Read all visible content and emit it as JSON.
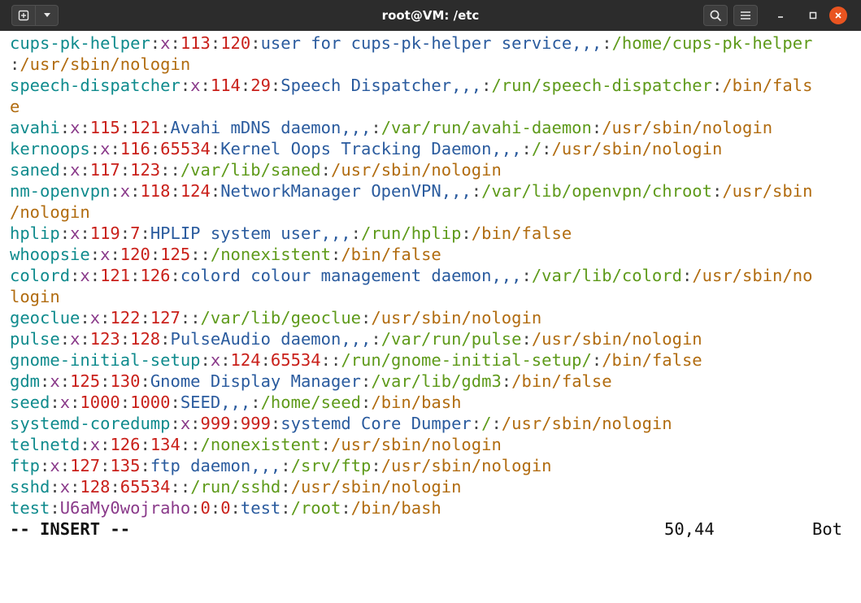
{
  "window": {
    "title": "root@VM: /etc",
    "new_tab_icon": "new-tab-icon",
    "dropdown_icon": "chevron-down-icon",
    "search_icon": "search-icon",
    "menu_icon": "hamburger-menu-icon",
    "minimize_icon": "minimize-icon",
    "maximize_icon": "maximize-icon",
    "close_icon": "close-icon",
    "close_color": "#e95420"
  },
  "terminal": {
    "lines": [
      [
        [
          "cups-pk-helper",
          "user"
        ],
        [
          ":",
          "sep"
        ],
        [
          "x",
          "pw"
        ],
        [
          ":",
          "sep"
        ],
        [
          "113",
          "id"
        ],
        [
          ":",
          "sep"
        ],
        [
          "120",
          "id"
        ],
        [
          ":",
          "sep"
        ],
        [
          "user for cups-pk-helper service,,,",
          "desc"
        ],
        [
          ":",
          "sep"
        ],
        [
          "/home/cups-pk-helper",
          "home"
        ]
      ],
      [
        [
          ":",
          "sep"
        ],
        [
          "/usr/sbin/nologin",
          "shell"
        ]
      ],
      [
        [
          "speech-dispatcher",
          "user"
        ],
        [
          ":",
          "sep"
        ],
        [
          "x",
          "pw"
        ],
        [
          ":",
          "sep"
        ],
        [
          "114",
          "id"
        ],
        [
          ":",
          "sep"
        ],
        [
          "29",
          "id"
        ],
        [
          ":",
          "sep"
        ],
        [
          "Speech Dispatcher,,,",
          "desc"
        ],
        [
          ":",
          "sep"
        ],
        [
          "/run/speech-dispatcher",
          "home"
        ],
        [
          ":",
          "sep"
        ],
        [
          "/bin/fals",
          "shell"
        ]
      ],
      [
        [
          "e",
          "shell"
        ]
      ],
      [
        [
          "avahi",
          "user"
        ],
        [
          ":",
          "sep"
        ],
        [
          "x",
          "pw"
        ],
        [
          ":",
          "sep"
        ],
        [
          "115",
          "id"
        ],
        [
          ":",
          "sep"
        ],
        [
          "121",
          "id"
        ],
        [
          ":",
          "sep"
        ],
        [
          "Avahi mDNS daemon,,,",
          "desc"
        ],
        [
          ":",
          "sep"
        ],
        [
          "/var/run/avahi-daemon",
          "home"
        ],
        [
          ":",
          "sep"
        ],
        [
          "/usr/sbin/nologin",
          "shell"
        ]
      ],
      [
        [
          "kernoops",
          "user"
        ],
        [
          ":",
          "sep"
        ],
        [
          "x",
          "pw"
        ],
        [
          ":",
          "sep"
        ],
        [
          "116",
          "id"
        ],
        [
          ":",
          "sep"
        ],
        [
          "65534",
          "id"
        ],
        [
          ":",
          "sep"
        ],
        [
          "Kernel Oops Tracking Daemon,,,",
          "desc"
        ],
        [
          ":",
          "sep"
        ],
        [
          "/",
          "home"
        ],
        [
          ":",
          "sep"
        ],
        [
          "/usr/sbin/nologin",
          "shell"
        ]
      ],
      [
        [
          "saned",
          "user"
        ],
        [
          ":",
          "sep"
        ],
        [
          "x",
          "pw"
        ],
        [
          ":",
          "sep"
        ],
        [
          "117",
          "id"
        ],
        [
          ":",
          "sep"
        ],
        [
          "123",
          "id"
        ],
        [
          ":",
          "sep"
        ],
        [
          ":",
          "sep"
        ],
        [
          "/var/lib/saned",
          "home"
        ],
        [
          ":",
          "sep"
        ],
        [
          "/usr/sbin/nologin",
          "shell"
        ]
      ],
      [
        [
          "nm-openvpn",
          "user"
        ],
        [
          ":",
          "sep"
        ],
        [
          "x",
          "pw"
        ],
        [
          ":",
          "sep"
        ],
        [
          "118",
          "id"
        ],
        [
          ":",
          "sep"
        ],
        [
          "124",
          "id"
        ],
        [
          ":",
          "sep"
        ],
        [
          "NetworkManager OpenVPN,,,",
          "desc"
        ],
        [
          ":",
          "sep"
        ],
        [
          "/var/lib/openvpn/chroot",
          "home"
        ],
        [
          ":",
          "sep"
        ],
        [
          "/usr/sbin",
          "shell"
        ]
      ],
      [
        [
          "/nologin",
          "shell"
        ]
      ],
      [
        [
          "hplip",
          "user"
        ],
        [
          ":",
          "sep"
        ],
        [
          "x",
          "pw"
        ],
        [
          ":",
          "sep"
        ],
        [
          "119",
          "id"
        ],
        [
          ":",
          "sep"
        ],
        [
          "7",
          "id"
        ],
        [
          ":",
          "sep"
        ],
        [
          "HPLIP system user,,,",
          "desc"
        ],
        [
          ":",
          "sep"
        ],
        [
          "/run/hplip",
          "home"
        ],
        [
          ":",
          "sep"
        ],
        [
          "/bin/false",
          "shell"
        ]
      ],
      [
        [
          "whoopsie",
          "user"
        ],
        [
          ":",
          "sep"
        ],
        [
          "x",
          "pw"
        ],
        [
          ":",
          "sep"
        ],
        [
          "120",
          "id"
        ],
        [
          ":",
          "sep"
        ],
        [
          "125",
          "id"
        ],
        [
          ":",
          "sep"
        ],
        [
          ":",
          "sep"
        ],
        [
          "/nonexistent",
          "home"
        ],
        [
          ":",
          "sep"
        ],
        [
          "/bin/false",
          "shell"
        ]
      ],
      [
        [
          "colord",
          "user"
        ],
        [
          ":",
          "sep"
        ],
        [
          "x",
          "pw"
        ],
        [
          ":",
          "sep"
        ],
        [
          "121",
          "id"
        ],
        [
          ":",
          "sep"
        ],
        [
          "126",
          "id"
        ],
        [
          ":",
          "sep"
        ],
        [
          "colord colour management daemon,,,",
          "desc"
        ],
        [
          ":",
          "sep"
        ],
        [
          "/var/lib/colord",
          "home"
        ],
        [
          ":",
          "sep"
        ],
        [
          "/usr/sbin/no",
          "shell"
        ]
      ],
      [
        [
          "login",
          "shell"
        ]
      ],
      [
        [
          "geoclue",
          "user"
        ],
        [
          ":",
          "sep"
        ],
        [
          "x",
          "pw"
        ],
        [
          ":",
          "sep"
        ],
        [
          "122",
          "id"
        ],
        [
          ":",
          "sep"
        ],
        [
          "127",
          "id"
        ],
        [
          ":",
          "sep"
        ],
        [
          ":",
          "sep"
        ],
        [
          "/var/lib/geoclue",
          "home"
        ],
        [
          ":",
          "sep"
        ],
        [
          "/usr/sbin/nologin",
          "shell"
        ]
      ],
      [
        [
          "pulse",
          "user"
        ],
        [
          ":",
          "sep"
        ],
        [
          "x",
          "pw"
        ],
        [
          ":",
          "sep"
        ],
        [
          "123",
          "id"
        ],
        [
          ":",
          "sep"
        ],
        [
          "128",
          "id"
        ],
        [
          ":",
          "sep"
        ],
        [
          "PulseAudio daemon,,,",
          "desc"
        ],
        [
          ":",
          "sep"
        ],
        [
          "/var/run/pulse",
          "home"
        ],
        [
          ":",
          "sep"
        ],
        [
          "/usr/sbin/nologin",
          "shell"
        ]
      ],
      [
        [
          "gnome-initial-setup",
          "user"
        ],
        [
          ":",
          "sep"
        ],
        [
          "x",
          "pw"
        ],
        [
          ":",
          "sep"
        ],
        [
          "124",
          "id"
        ],
        [
          ":",
          "sep"
        ],
        [
          "65534",
          "id"
        ],
        [
          ":",
          "sep"
        ],
        [
          ":",
          "sep"
        ],
        [
          "/run/gnome-initial-setup/",
          "home"
        ],
        [
          ":",
          "sep"
        ],
        [
          "/bin/false",
          "shell"
        ]
      ],
      [
        [
          "gdm",
          "user"
        ],
        [
          ":",
          "sep"
        ],
        [
          "x",
          "pw"
        ],
        [
          ":",
          "sep"
        ],
        [
          "125",
          "id"
        ],
        [
          ":",
          "sep"
        ],
        [
          "130",
          "id"
        ],
        [
          ":",
          "sep"
        ],
        [
          "Gnome Display Manager",
          "desc"
        ],
        [
          ":",
          "sep"
        ],
        [
          "/var/lib/gdm3",
          "home"
        ],
        [
          ":",
          "sep"
        ],
        [
          "/bin/false",
          "shell"
        ]
      ],
      [
        [
          "seed",
          "user"
        ],
        [
          ":",
          "sep"
        ],
        [
          "x",
          "pw"
        ],
        [
          ":",
          "sep"
        ],
        [
          "1000",
          "id"
        ],
        [
          ":",
          "sep"
        ],
        [
          "1000",
          "id"
        ],
        [
          ":",
          "sep"
        ],
        [
          "SEED,,,",
          "desc"
        ],
        [
          ":",
          "sep"
        ],
        [
          "/home/seed",
          "home"
        ],
        [
          ":",
          "sep"
        ],
        [
          "/bin/bash",
          "shell"
        ]
      ],
      [
        [
          "systemd-coredump",
          "user"
        ],
        [
          ":",
          "sep"
        ],
        [
          "x",
          "pw"
        ],
        [
          ":",
          "sep"
        ],
        [
          "999",
          "id"
        ],
        [
          ":",
          "sep"
        ],
        [
          "999",
          "id"
        ],
        [
          ":",
          "sep"
        ],
        [
          "systemd Core Dumper",
          "desc"
        ],
        [
          ":",
          "sep"
        ],
        [
          "/",
          "home"
        ],
        [
          ":",
          "sep"
        ],
        [
          "/usr/sbin/nologin",
          "shell"
        ]
      ],
      [
        [
          "telnetd",
          "user"
        ],
        [
          ":",
          "sep"
        ],
        [
          "x",
          "pw"
        ],
        [
          ":",
          "sep"
        ],
        [
          "126",
          "id"
        ],
        [
          ":",
          "sep"
        ],
        [
          "134",
          "id"
        ],
        [
          ":",
          "sep"
        ],
        [
          ":",
          "sep"
        ],
        [
          "/nonexistent",
          "home"
        ],
        [
          ":",
          "sep"
        ],
        [
          "/usr/sbin/nologin",
          "shell"
        ]
      ],
      [
        [
          "ftp",
          "user"
        ],
        [
          ":",
          "sep"
        ],
        [
          "x",
          "pw"
        ],
        [
          ":",
          "sep"
        ],
        [
          "127",
          "id"
        ],
        [
          ":",
          "sep"
        ],
        [
          "135",
          "id"
        ],
        [
          ":",
          "sep"
        ],
        [
          "ftp daemon,,,",
          "desc"
        ],
        [
          ":",
          "sep"
        ],
        [
          "/srv/ftp",
          "home"
        ],
        [
          ":",
          "sep"
        ],
        [
          "/usr/sbin/nologin",
          "shell"
        ]
      ],
      [
        [
          "sshd",
          "user"
        ],
        [
          ":",
          "sep"
        ],
        [
          "x",
          "pw"
        ],
        [
          ":",
          "sep"
        ],
        [
          "128",
          "id"
        ],
        [
          ":",
          "sep"
        ],
        [
          "65534",
          "id"
        ],
        [
          ":",
          "sep"
        ],
        [
          ":",
          "sep"
        ],
        [
          "/run/sshd",
          "home"
        ],
        [
          ":",
          "sep"
        ],
        [
          "/usr/sbin/nologin",
          "shell"
        ]
      ],
      [
        [
          "test",
          "user"
        ],
        [
          ":",
          "sep"
        ],
        [
          "U6aMy0wojraho",
          "pw"
        ],
        [
          ":",
          "sep"
        ],
        [
          "0",
          "id"
        ],
        [
          ":",
          "sep"
        ],
        [
          "0",
          "id"
        ],
        [
          ":",
          "sep"
        ],
        [
          "test",
          "desc"
        ],
        [
          ":",
          "sep"
        ],
        [
          "/root",
          "home"
        ],
        [
          ":",
          "sep"
        ],
        [
          "/bin/bash",
          "shell"
        ]
      ]
    ]
  },
  "statusline": {
    "mode": "-- INSERT --",
    "position": "50,44",
    "scroll": "Bot"
  }
}
